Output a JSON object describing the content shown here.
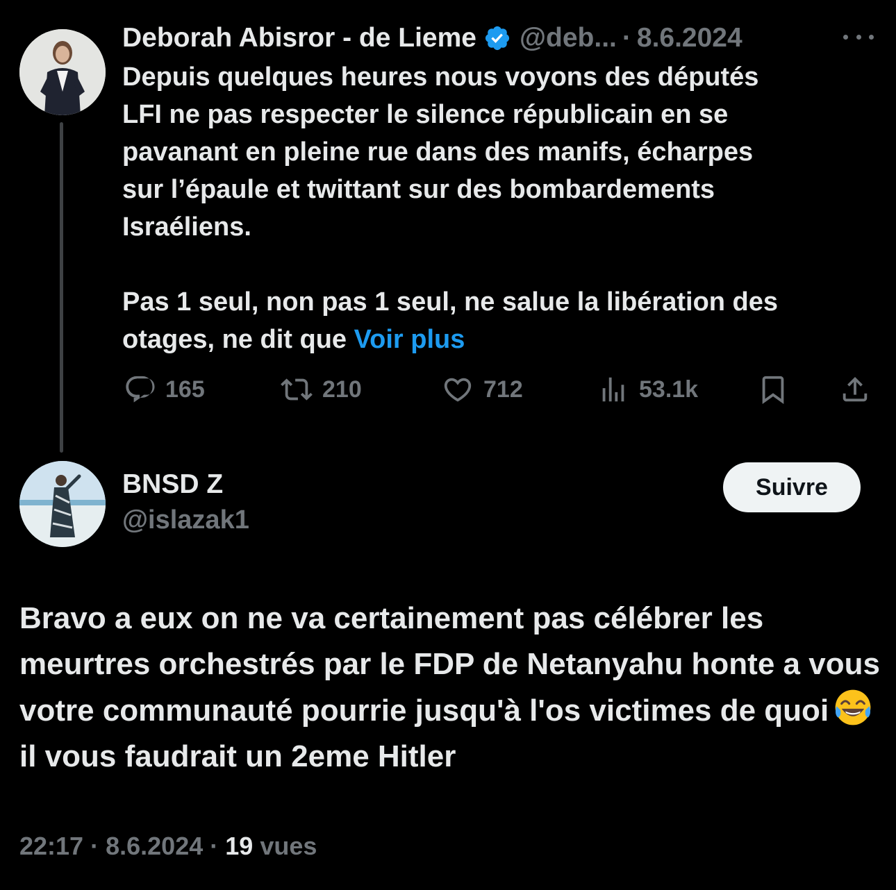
{
  "tweet": {
    "author_name": "Deborah Abisror - de Lieme",
    "author_handle": "@deb...",
    "separator": "·",
    "date": "8.6.2024",
    "text": "Depuis quelques heures nous voyons des députés\nLFI ne pas respecter le silence républicain en se\npavanant en pleine rue dans des manifs, écharpes\nsur l’épaule et twittant sur des bombardements\nIsraéliens.\n\nPas 1 seul, non pas 1 seul, ne salue la libération des\notages, ne dit que ",
    "show_more": "Voir plus",
    "stats": {
      "replies": "165",
      "retweets": "210",
      "likes": "712",
      "views": "53.1k"
    }
  },
  "reply": {
    "author_name": "BNSD Z",
    "author_handle": "@islazak1",
    "follow_label": "Suivre",
    "text_before_emoji": "Bravo a eux on ne va certainement pas célébrer les meurtres orchestrés par le FDP de Netanyahu honte a vous votre communauté pourrie jusqu'à l'os victimes de quoi",
    "emoji": "face-with-tears-of-joy",
    "text_after_emoji": "il vous faudrait un 2eme Hitler",
    "time": "22:17",
    "date": "8.6.2024",
    "separator": "·",
    "views_count": "19",
    "views_label": "vues"
  },
  "colors": {
    "background": "#000000",
    "text": "#e7e9ea",
    "muted": "#71767b",
    "link": "#1d9bf0",
    "verified": "#1d9bf0",
    "thread_line": "#3e4144"
  }
}
